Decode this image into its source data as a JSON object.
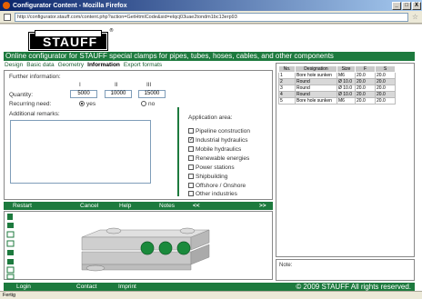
{
  "window": {
    "title": "Configurator Content - Mozilla Firefox",
    "min_label": "_",
    "max_label": "□",
    "close_label": "X"
  },
  "address": {
    "url": "http://configurator.stauff.com/content.php?action=GetHtmlCode&sid=elqcj03uae2tondm1bc13erp93"
  },
  "logo": {
    "text": "STAUFF",
    "reg": "®"
  },
  "banner": "Online configurator for STAUFF special clamps for pipes, tubes, hoses, cables, and other components",
  "tabs": [
    "Design",
    "Basic data",
    "Geometry",
    "Information",
    "Export formats"
  ],
  "form": {
    "further_info": "Further information:",
    "col_i": "I",
    "col_ii": "II",
    "col_iii": "III",
    "quantity_label": "Quantity:",
    "quantities": [
      "5000",
      "10000",
      "15000"
    ],
    "recurring_label": "Recurring need:",
    "yes_label": "yes",
    "no_label": "no",
    "remarks_label": "Additional remarks:",
    "app_area_label": "Application area:",
    "app_areas": [
      {
        "label": "Pipeline construction",
        "checked": false
      },
      {
        "label": "Industrial hydraulics",
        "checked": true
      },
      {
        "label": "Mobile hydraulics",
        "checked": false
      },
      {
        "label": "Renewable energies",
        "checked": false
      },
      {
        "label": "Power stations",
        "checked": false
      },
      {
        "label": "Shipbuilding",
        "checked": false
      },
      {
        "label": "Offshore / Onshore",
        "checked": false
      },
      {
        "label": "Other industries",
        "checked": false
      }
    ]
  },
  "navbar": {
    "restart": "Restart",
    "cancel": "Cancel",
    "help": "Help",
    "notes": "Notes",
    "prev": "<<",
    "next": ">>"
  },
  "parts_table": {
    "headers": [
      "No.",
      "Designation",
      "Size",
      "F",
      "S"
    ],
    "rows": [
      [
        "1",
        "Bore hole sunken",
        "M6",
        "20.0",
        "20.0"
      ],
      [
        "2",
        "Round",
        "Ø 10.0",
        "20.0",
        "20.0"
      ],
      [
        "3",
        "Round",
        "Ø 10.0",
        "20.0",
        "20.0"
      ],
      [
        "4",
        "Round",
        "Ø 10.0",
        "20.0",
        "20.0"
      ],
      [
        "5",
        "Bore hole sunken",
        "M6",
        "20.0",
        "20.0"
      ]
    ]
  },
  "note_label": "Note:",
  "footer": {
    "login": "Login",
    "contact": "Contact",
    "imprint": "Imprint",
    "copyright": "© 2009 STAUFF All rights reserved."
  },
  "status": "Fertig",
  "colors": {
    "brand_green": "#1d7a3e"
  }
}
